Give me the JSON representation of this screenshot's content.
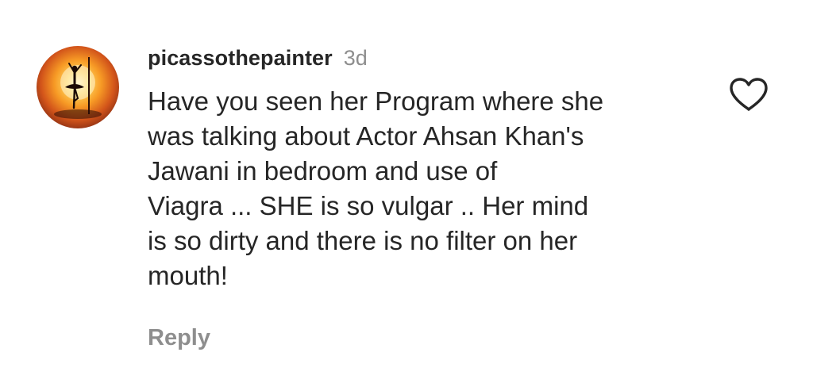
{
  "comment": {
    "username": "picassothepainter",
    "time_ago": "3d",
    "text_lines": [
      "Have you seen her Program where she",
      "was talking about Actor Ahsan Khan's",
      "Jawani in bedroom and use of",
      "Viagra ... SHE is so vulgar .. Her mind",
      "is so dirty and there is no filter on her",
      "mouth!"
    ],
    "reply_label": "Reply",
    "like_icon": "heart-outline-icon",
    "avatar_icon": "ballerina-silhouette-icon"
  },
  "colors": {
    "text_primary": "#262626",
    "text_secondary": "#8e8e8e",
    "background": "#ffffff"
  }
}
